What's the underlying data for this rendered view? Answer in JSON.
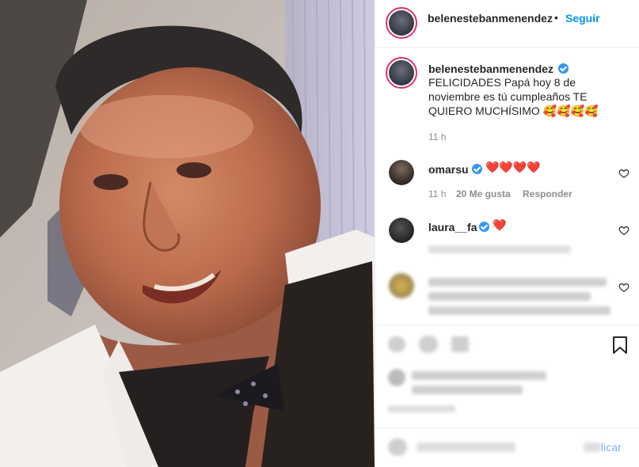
{
  "post": {
    "image_alt_subject": "",
    "author": {
      "username": "belenestebanmenendez",
      "verified": true,
      "follow_label": "Seguir",
      "separator": "•"
    },
    "caption": {
      "username": "belenestebanmenendez",
      "text": "FELICIDADES Papá hoy 8 de noviembre es tú cumpleaños TE QUIERO MUCHÍSIMO 🥰🥰🥰🥰",
      "time": "11 h"
    },
    "comments": [
      {
        "username": "omarsu",
        "verified": true,
        "text": "❤️❤️❤️❤️",
        "time": "11 h",
        "likes": "20 Me gusta",
        "reply_label": "Responder"
      },
      {
        "username": "laura__fa",
        "verified": true,
        "text": "❤️"
      }
    ],
    "add_comment": {
      "post_label": "licar"
    }
  },
  "colors": {
    "link_blue": "#0095f6",
    "verified_blue": "#3897f0",
    "story_ring": "#e1306c",
    "heart_red": "#ed1c24"
  },
  "icons": {
    "verified": "verified-badge-icon",
    "like": "heart-outline-icon",
    "save": "bookmark-icon"
  }
}
